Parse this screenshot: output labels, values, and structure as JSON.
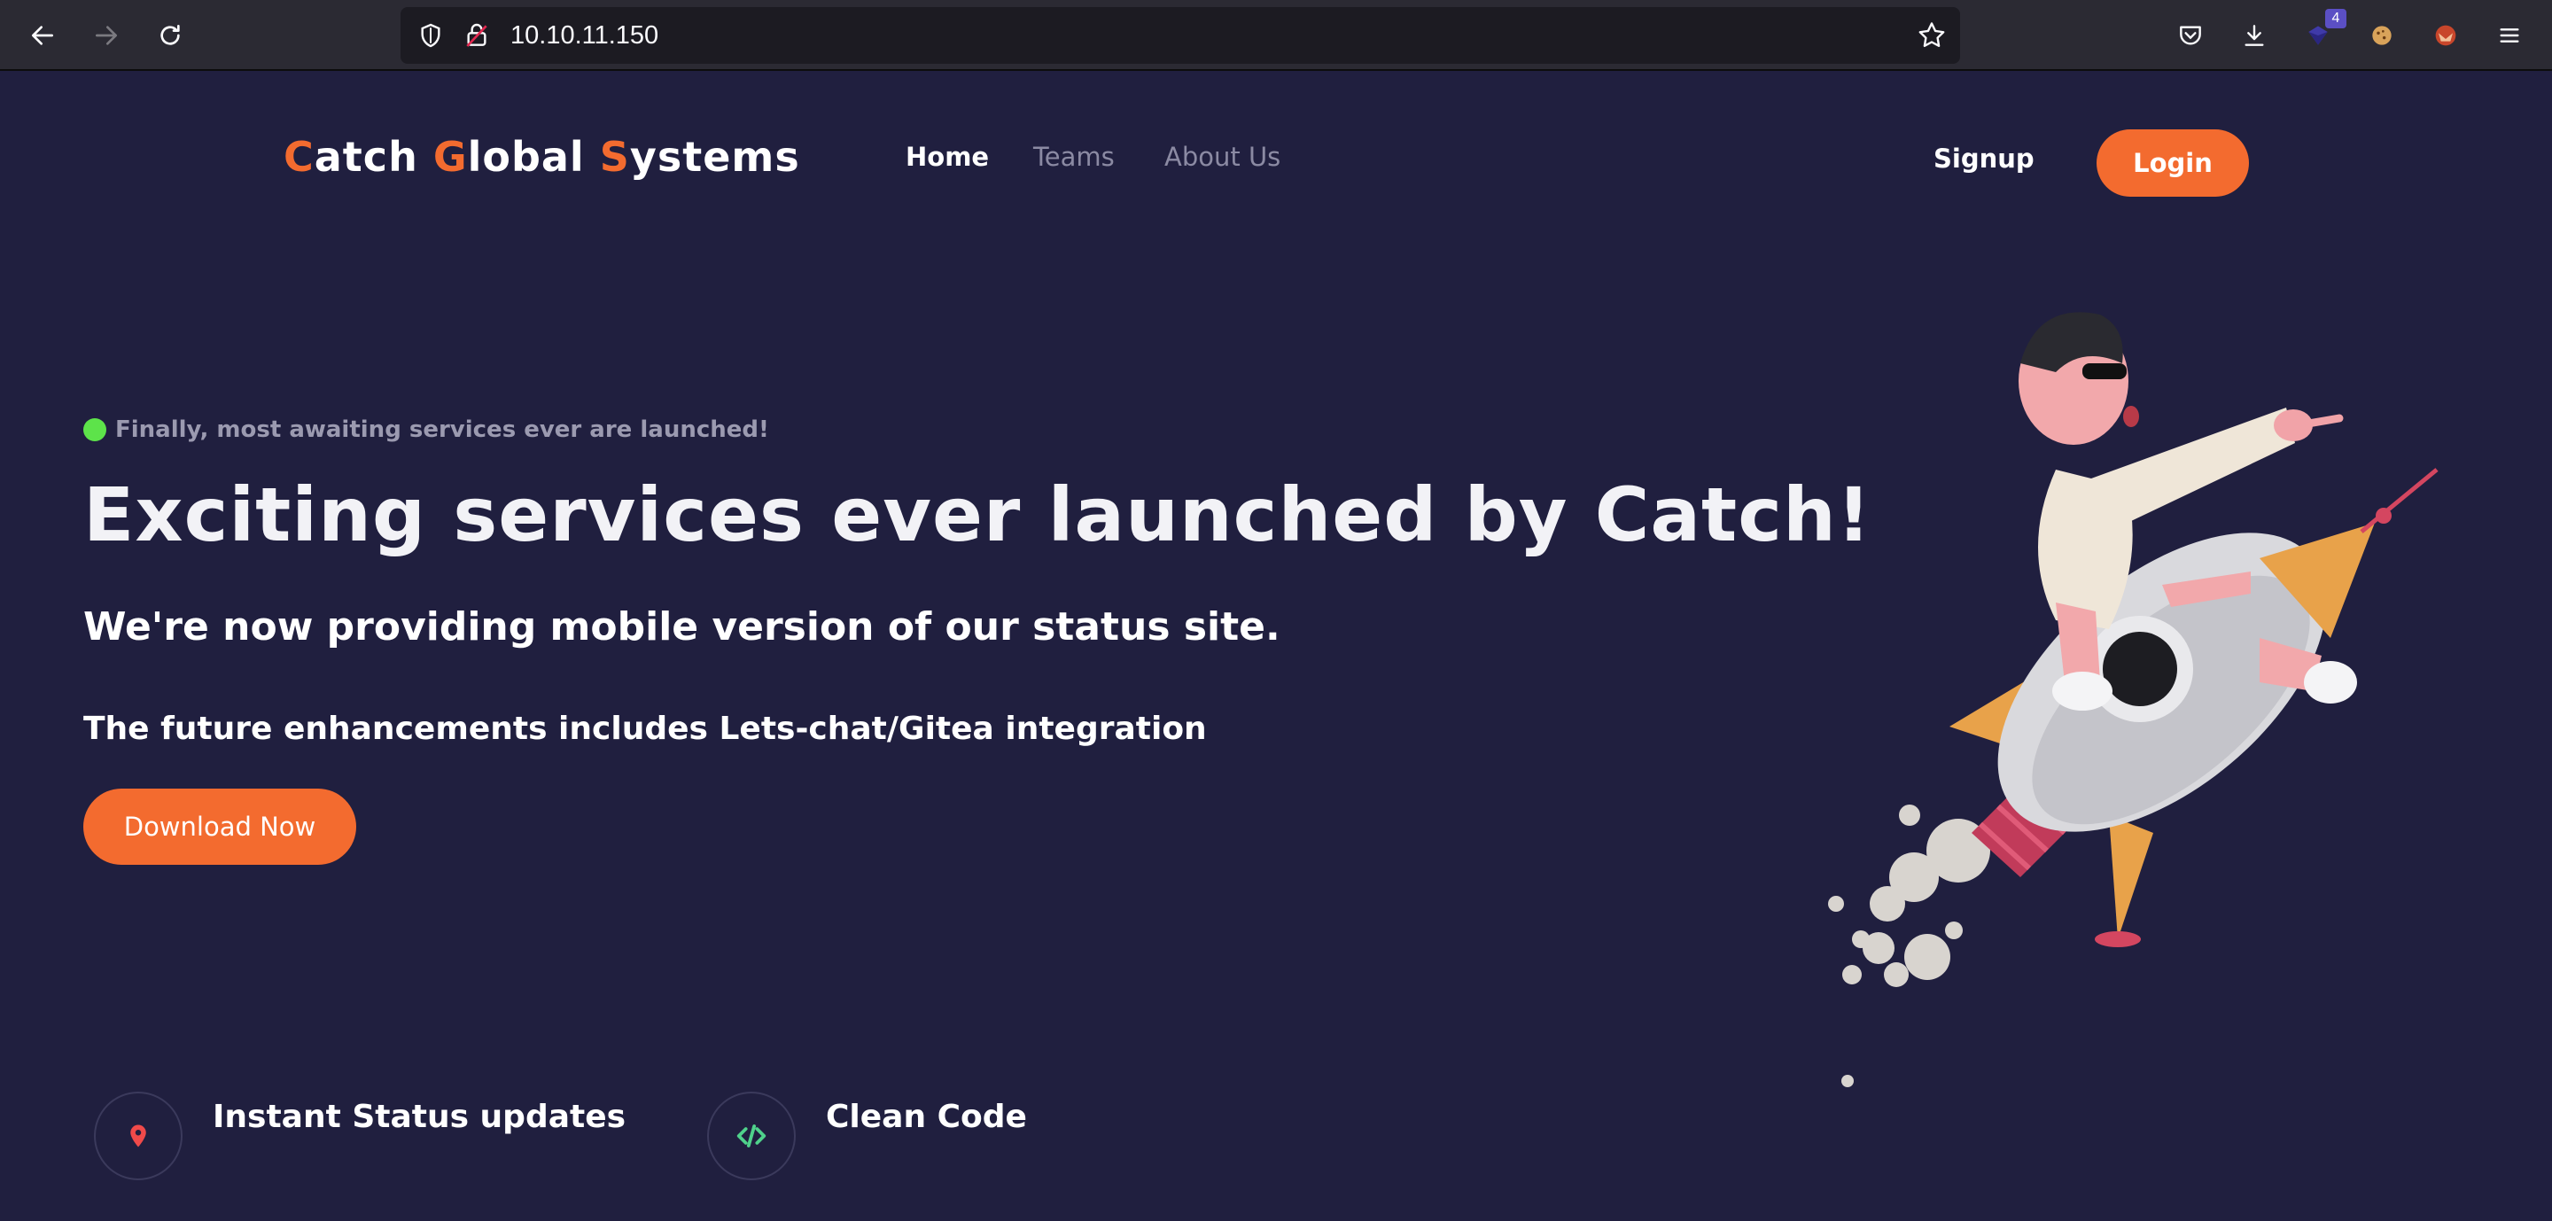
{
  "browser": {
    "url": "10.10.11.150",
    "extension_badge": "4"
  },
  "header": {
    "brand": [
      {
        "accent": "C",
        "rest": "atch "
      },
      {
        "accent": "G",
        "rest": "lobal "
      },
      {
        "accent": "S",
        "rest": "ystems"
      }
    ],
    "nav": [
      {
        "label": "Home",
        "state": "active"
      },
      {
        "label": "Teams",
        "state": "muted"
      },
      {
        "label": "About Us",
        "state": "muted"
      }
    ],
    "signup_label": "Signup",
    "login_label": "Login"
  },
  "hero": {
    "status": "Finally, most awaiting services ever are launched!",
    "title": "Exciting services ever launched by Catch!",
    "subtitle": "We're now providing mobile version of our status site.",
    "subtitle2": "The future enhancements includes Lets-chat/Gitea integration",
    "download_label": "Download Now"
  },
  "features": [
    {
      "title": "Instant Status updates",
      "icon": "map-pin-icon"
    },
    {
      "title": "Clean Code",
      "icon": "code-icon"
    }
  ],
  "colors": {
    "background": "#201f3f",
    "accent": "#f36b2f",
    "status_dot": "#5de34a",
    "code_icon": "#4fd18b",
    "pin_icon": "#f04a4a"
  }
}
